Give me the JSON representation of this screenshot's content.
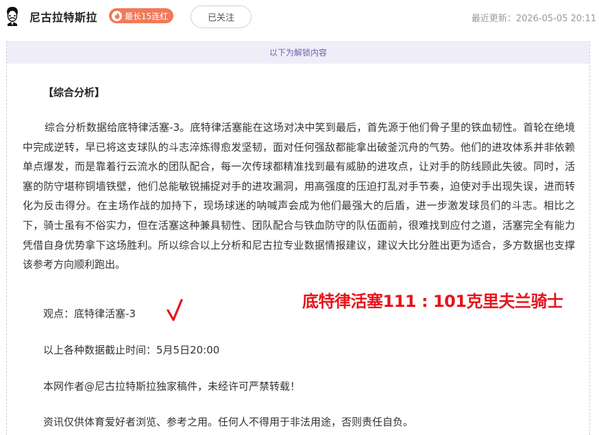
{
  "header": {
    "avatar_icon": "tesla-portrait-avatar",
    "author_name": "尼古拉特斯拉",
    "streak_badge": "最长15连红",
    "streak_icon": "fire-icon",
    "follow_label": "已关注",
    "update_time": "最近更新：2026-05-05 20:11"
  },
  "content": {
    "unlock_notice": "以下为解锁内容",
    "section_heading": "【综合分析】",
    "analysis_paragraph": "综合分析数据给底特律活塞-3。底特律活塞能在这场对决中笑到最后，首先源于他们骨子里的铁血韧性。首轮在绝境中完成逆转，早已将这支球队的斗志淬炼得愈发坚韧，面对任何强敌都能拿出破釜沉舟的气势。他们的进攻体系并非依赖单点爆发，而是靠着行云流水的团队配合，每一次传球都精准找到最有威胁的进攻点，让对手的防线顾此失彼。同时，活塞的防守堪称铜墙铁壁，他们总能敏锐捕捉对手的进攻漏洞，用高强度的压迫打乱对手节奏，迫使对手出现失误，进而转化为反击得分。在主场作战的加持下，现场球迷的呐喊声会成为他们最强大的后盾，进一步激发球员们的斗志。相比之下，骑士虽有不俗实力，但在活塞这种兼具韧性、团队配合与铁血防守的队伍面前，很难找到应付之道，活塞完全有能力凭借自身优势拿下这场胜利。所以综合以上分析和尼古拉专业数据情报建议，建议大比分胜出更为适合，多方数据也支撑该参考方向顺利跑出。",
    "opinion": "观点：底特律活塞-3",
    "check_icon": "red-check-mark",
    "check_color": "#e8131b",
    "score_result": "底特律活塞111 : 101克里夫兰骑士",
    "data_cutoff": "以上各种数据截止时间：5月5日20:00",
    "copyright": "本网作者@尼古拉特斯拉独家稿件，未经许可严禁转载！",
    "disclaimer": "资讯仅供体育爱好者浏览、参考之用。任何人不得用于非法用途，否则责任自负。"
  },
  "colors": {
    "badge": "#f07a5a",
    "unlock_bar_bg": "#efeef8",
    "unlock_bar_text": "#6a5fb0",
    "score_red": "#e8131b"
  }
}
